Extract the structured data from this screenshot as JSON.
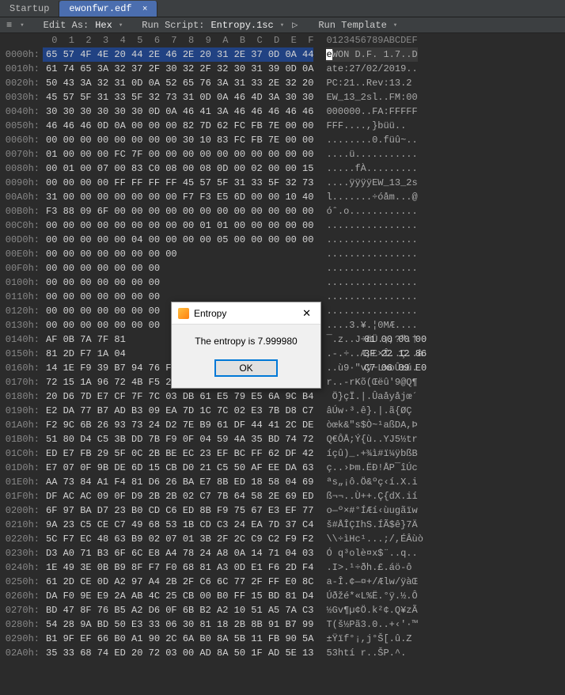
{
  "tabs": {
    "inactive": "Startup",
    "active": "ewonfwr.edf",
    "close_glyph": "×"
  },
  "toolbar": {
    "edit_as_label": "Edit As:",
    "edit_as_value": "Hex",
    "run_script_label": "Run Script:",
    "run_script_value": "Entropy.1sc",
    "run_template_label": "Run Template"
  },
  "columns": {
    "hex": " 0  1  2  3  4  5  6  7  8  9  A  B  C  D  E  F",
    "ascii": "0123456789ABCDEF"
  },
  "rows": [
    {
      "off": "0000h:",
      "hex": "65 57 4F 4E 20 44 2E 46 2E 20 31 2E 37 0D 0A 44",
      "asc": "eWON D.F. 1.7..D",
      "sel": 1,
      "cur": 1
    },
    {
      "off": "0010h:",
      "hex": "61 74 65 3A 32 37 2F 30 32 2F 32 30 31 39 0D 0A",
      "asc": "ate:27/02/2019.."
    },
    {
      "off": "0020h:",
      "hex": "50 43 3A 32 31 0D 0A 52 65 76 3A 31 33 2E 32 20",
      "asc": "PC:21..Rev:13.2 "
    },
    {
      "off": "0030h:",
      "hex": "45 57 5F 31 33 5F 32 73 31 0D 0A 46 4D 3A 30 30",
      "asc": "EW_13_2sl..FM:00"
    },
    {
      "off": "0040h:",
      "hex": "30 30 30 30 30 30 0D 0A 46 41 3A 46 46 46 46 46",
      "asc": "000000..FA:FFFFF"
    },
    {
      "off": "0050h:",
      "hex": "46 46 46 0D 0A 00 00 00 82 7D 62 FC FB 7E 00 00",
      "asc": "FFF....,}büü.."
    },
    {
      "off": "0060h:",
      "hex": "00 00 00 00 00 00 00 00 30 10 83 FC FB 7E 00 00",
      "asc": "........0.füû~.."
    },
    {
      "off": "0070h:",
      "hex": "01 00 00 00 FC 7F 00 00 00 00 00 00 00 00 00 00",
      "asc": "....ü..........."
    },
    {
      "off": "0080h:",
      "hex": "00 01 00 07 00 83 C0 08 00 08 0D 00 02 00 00 15",
      "asc": ".....fÀ........."
    },
    {
      "off": "0090h:",
      "hex": "00 00 00 00 FF FF FF FF 45 57 5F 31 33 5F 32 73",
      "asc": "....ÿÿÿÿEW_13_2s"
    },
    {
      "off": "00A0h:",
      "hex": "31 00 00 00 00 00 00 00 F7 F3 E5 6D 00 00 10 40",
      "asc": "l.......÷óåm...@"
    },
    {
      "off": "00B0h:",
      "hex": "F3 88 09 6F 00 00 00 00 00 00 00 00 00 00 00 00",
      "asc": "óˆ.o............"
    },
    {
      "off": "00C0h:",
      "hex": "00 00 00 00 00 00 00 00 00 01 01 00 00 00 00 00",
      "asc": "................"
    },
    {
      "off": "00D0h:",
      "hex": "00 00 00 00 00 04 00 00 00 00 05 00 00 00 00 00",
      "asc": "................"
    },
    {
      "off": "00E0h:",
      "hex": "00 00 00 00 00 00 00 00                        ",
      "asc": "................"
    },
    {
      "off": "00F0h:",
      "hex": "00 00 00 00 00 00 00                           ",
      "asc": "................"
    },
    {
      "off": "0100h:",
      "hex": "00 00 00 00 00 00 00                           ",
      "asc": "................"
    },
    {
      "off": "0110h:",
      "hex": "00 00 00 00 00 00 00                           ",
      "asc": "................"
    },
    {
      "off": "0120h:",
      "hex": "00 00 00 00 00 00 00                           ",
      "asc": "................"
    },
    {
      "off": "0130h:",
      "hex": "00 00 00 00 00 00 00                           ",
      "asc": "....3.¥.¦0MÆ...."
    },
    {
      "off": "0140h:",
      "hex": "AF 0B 7A 7F 81                                 ",
      "asc": "¯.z..J÷öÜ.¡,?\".†"
    },
    {
      "off": "0150h:",
      "hex": "81 2D F7 1A 04                                 ",
      "asc": ".-.÷..Æ,£×Î..Ç..à"
    },
    {
      "off": "0160h:",
      "hex": "14 1E F9 39 B7 94 76 FF 7E 4C 78 6F DB B1 FA 08",
      "asc": "..ù9·\"vÿ~LxoÛ±ú."
    },
    {
      "off": "0170h:",
      "hex": "72 15 1A 96 72 4B F5 28 8C EB FB 92 39 40 51 B6",
      "asc": "r..-rKõ(Œëû'9@Q¶"
    },
    {
      "off": "0180h:",
      "hex": "20 D6 7D E7 CF 7F 7C 03 DB 61 E5 79 E5 6A 9C B4",
      "asc": " Ö}çÏ.|.Ûaåyåjœ´"
    },
    {
      "off": "0190h:",
      "hex": "E2 DA 77 B7 AD B3 09 EA 7D 1C 7C 02 E3 7B D8 C7",
      "asc": "âÚw·­³.ê}.|.ã{ØÇ"
    },
    {
      "off": "01A0h:",
      "hex": "F2 9C 6B 26 93 73 24 D2 7E B9 61 DF 44 41 2C DE",
      "asc": "òœk&\"s$Ò~¹aßDA,Þ"
    },
    {
      "off": "01B0h:",
      "hex": "51 80 D4 C5 3B DD 7B F9 0F 04 59 4A 35 BD 74 72",
      "asc": "Q€ÔÅ;Ý{ù..YJ5½tr"
    },
    {
      "off": "01C0h:",
      "hex": "ED E7 FB 29 5F 0C 2B BE EC 23 EF BC FF 62 DF 42",
      "asc": "íçû)_.+¾ì#ï¼ÿbßB"
    },
    {
      "off": "01D0h:",
      "hex": "E7 07 0F 9B DE 6D 15 CB D0 21 C5 50 AF EE DA 63",
      "asc": "ç..›Þm.ËÐ!ÅP¯îÚc"
    },
    {
      "off": "01E0h:",
      "hex": "AA 73 84 A1 F4 81 D6 26 BA E7 8B ED 18 58 04 69",
      "asc": "ªs„¡ô.Ö&ºç‹í.X.i"
    },
    {
      "off": "01F0h:",
      "hex": "DF AC AC 09 0F D9 2B 2B 02 C7 7B 64 58 2E 69 ED",
      "asc": "ß¬¬..Ù++.Ç{dX.ií"
    },
    {
      "off": "0200h:",
      "hex": "6F 97 BA D7 23 B0 CD C6 ED 8B F9 75 67 E3 EF 77",
      "asc": "o—º×#°ÍÆí‹ùugãïw"
    },
    {
      "off": "0210h:",
      "hex": "9A 23 C5 CE C7 49 68 53 1B CD C3 24 EA 7D 37 C4",
      "asc": "š#ÅÎÇIhS.ÍÃ$ê}7Ä"
    },
    {
      "off": "0220h:",
      "hex": "5C F7 EC 48 63 B9 02 07 01 3B 2F 2C C9 C2 F9 F2",
      "asc": "\\\\÷ìHc¹...;/,ÉÂùò"
    },
    {
      "off": "0230h:",
      "hex": "D3 A0 71 B3 6F 6C E8 A4 78 24 A8 0A 14 71 04 03",
      "asc": "Ó q³olè¤x$¨..q.."
    },
    {
      "off": "0240h:",
      "hex": "1E 49 3E 0B B9 8F F7 F0 68 81 A3 0D E1 F6 2D F4",
      "asc": ".I>.¹÷ðh.£.áö-ô"
    },
    {
      "off": "0250h:",
      "hex": "61 2D CE 0D A2 97 A4 2B 2F C6 6C 77 2F FF E0 8C",
      "asc": "a-Î.¢—¤+/Ælw/ÿàŒ"
    },
    {
      "off": "0260h:",
      "hex": "DA F0 9E E9 2A AB 4C 25 CB 00 B0 FF 15 BD 81 D4",
      "asc": "Úðžé*«L%Ë.°ÿ.½.Ô"
    },
    {
      "off": "0270h:",
      "hex": "BD 47 8F 76 B5 A2 D6 0F 6B B2 A2 10 51 A5 7A C3",
      "asc": "½Gv¶µ¢Ö.k²¢.Q¥zÃ"
    },
    {
      "off": "0280h:",
      "hex": "54 28 9A BD 50 E3 33 06 30 81 18 2B 8B 91 B7 99",
      "asc": "T(š½Pã3.0..+‹'·™"
    },
    {
      "off": "0290h:",
      "hex": "B1 9F EF 66 B0 A1 90 2C 6A B0 8A 5B 11 FB 90 5A",
      "asc": "±Ÿïf°¡,j°Š[.û.Z"
    },
    {
      "off": "02A0h:",
      "hex": "35 33 68 74 ED 20 72 03 00 AD 8A 50 1F AD 5E 13",
      "asc": "53htí r..­ŠP.­^."
    }
  ],
  "dialog_extras": {
    "r1": "01 00 00 00",
    "r2": "3F 22 12 86",
    "r3": "C7 06 09 E0"
  },
  "dialog": {
    "title": "Entropy",
    "message": "The entropy is 7.999980",
    "ok": "OK"
  }
}
